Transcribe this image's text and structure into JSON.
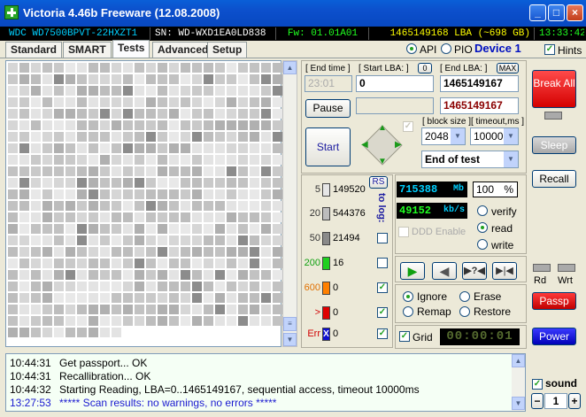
{
  "window": {
    "title": "Victoria 4.46b Freeware (12.08.2008)"
  },
  "infobar": {
    "model": "WDC WD7500BPVT-22HXZT1",
    "serial": "SN: WD-WXD1EA0LD838",
    "firmware": "Fw: 01.01A01",
    "lba": "1465149168 LBA (~698 GB)",
    "clock": "13:33:42"
  },
  "tabs": [
    "Standard",
    "SMART",
    "Tests",
    "Advanced",
    "Setup"
  ],
  "interface": {
    "api_label": "API",
    "pio_label": "PIO",
    "device_label": "Device 1",
    "hints_label": "Hints"
  },
  "controls": {
    "end_time_label": "[ End time ]",
    "end_time_value": "23:01",
    "start_lba_label": "[ Start LBA: ]",
    "start_lba_zero": "0",
    "start_lba_value": "0",
    "end_lba_label": "[ End LBA: ]",
    "end_lba_max": "MAX",
    "end_lba_value": "1465149167",
    "end_lba_current": "1465149167",
    "pause_label": "Pause",
    "start_label": "Start",
    "block_size_label": "[ block size ]",
    "block_size_value": "2048",
    "timeout_label": "[ timeout,ms ]",
    "timeout_value": "10000",
    "end_action_value": "End of test"
  },
  "stats": {
    "rs_label": "RS",
    "to_log_label": "to log:",
    "rows": [
      {
        "label": "5",
        "count": "149520",
        "color": "#e6e6e6"
      },
      {
        "label": "20",
        "count": "544376",
        "color": "#bdbdbd"
      },
      {
        "label": "50",
        "count": "21494",
        "color": "#8a8a8a"
      },
      {
        "label": "200",
        "count": "16",
        "color": "#20d020"
      },
      {
        "label": "600",
        "count": "0",
        "color": "#ff8000"
      },
      {
        "label": ">",
        "count": "0",
        "color": "#e00000"
      },
      {
        "label": "Err",
        "count": "0",
        "color": "#1010d0",
        "mark": "X"
      }
    ]
  },
  "progress": {
    "mb_value": "715388",
    "mb_unit": "Mb",
    "percent": "100",
    "percent_unit": "%",
    "speed_value": "49152",
    "speed_unit": "kb/s",
    "ddd_label": "DDD Enable"
  },
  "modes": {
    "verify": "verify",
    "read": "read",
    "write": "write"
  },
  "actions": {
    "ignore": "Ignore",
    "erase": "Erase",
    "remap": "Remap",
    "restore": "Restore",
    "grid": "Grid",
    "timer": "00:00:01"
  },
  "side": {
    "break_all": "Break All",
    "sleep": "Sleep",
    "recall": "Recall",
    "rd": "Rd",
    "wrt": "Wrt",
    "passp": "Passp",
    "power": "Power",
    "sound": "sound",
    "stepper_value": "1",
    "minus": "−",
    "plus": "+"
  },
  "log": [
    {
      "time": "10:44:31",
      "text": "Get passport... OK",
      "color": "#000000"
    },
    {
      "time": "10:44:31",
      "text": "Recallibration... OK",
      "color": "#000000"
    },
    {
      "time": "10:44:32",
      "text": "Starting Reading, LBA=0..1465149167, sequential access, timeout 10000ms",
      "color": "#000000"
    },
    {
      "time": "13:27:53",
      "text": "***** Scan results: no warnings, no errors *****",
      "color": "#1a1ad0"
    }
  ]
}
